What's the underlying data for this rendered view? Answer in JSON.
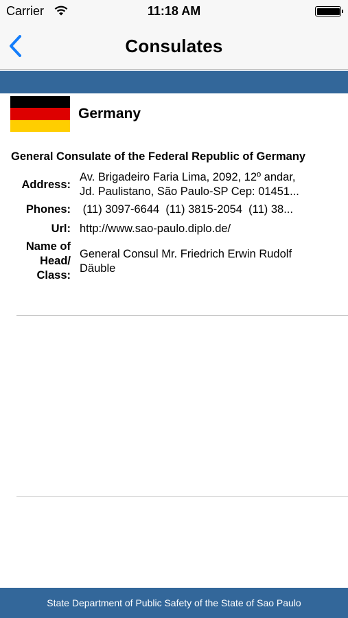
{
  "status_bar": {
    "carrier": "Carrier",
    "time": "11:18 AM"
  },
  "nav": {
    "title": "Consulates",
    "back_icon": "chevron-left-icon"
  },
  "country": {
    "name": "Germany",
    "flag_colors": [
      "#000000",
      "#dd0000",
      "#ffce00"
    ]
  },
  "consulate": {
    "title": "General Consulate of the Federal Republic of Germany",
    "address_label": "Address:",
    "address_line1": "Av. Brigadeiro Faria Lima, 2092, 12º andar,",
    "address_line2": "Jd. Paulistano, São Paulo-SP Cep: 01451...",
    "phones_label": "Phones:",
    "phones_value": " (11) 3097-6644  (11) 3815-2054  (11) 38...",
    "url_label": "Url:",
    "url_value": "http://www.sao-paulo.diplo.de/",
    "head_label_1": "Name of",
    "head_label_2": "Head/",
    "head_label_3": "Class:",
    "head_value": "General Consul Mr. Friedrich Erwin Rudolf Däuble"
  },
  "footer": {
    "text": "State Department of Public Safety of the State of Sao Paulo"
  },
  "colors": {
    "accent_blue": "#33679a",
    "ios_blue": "#157efb"
  }
}
